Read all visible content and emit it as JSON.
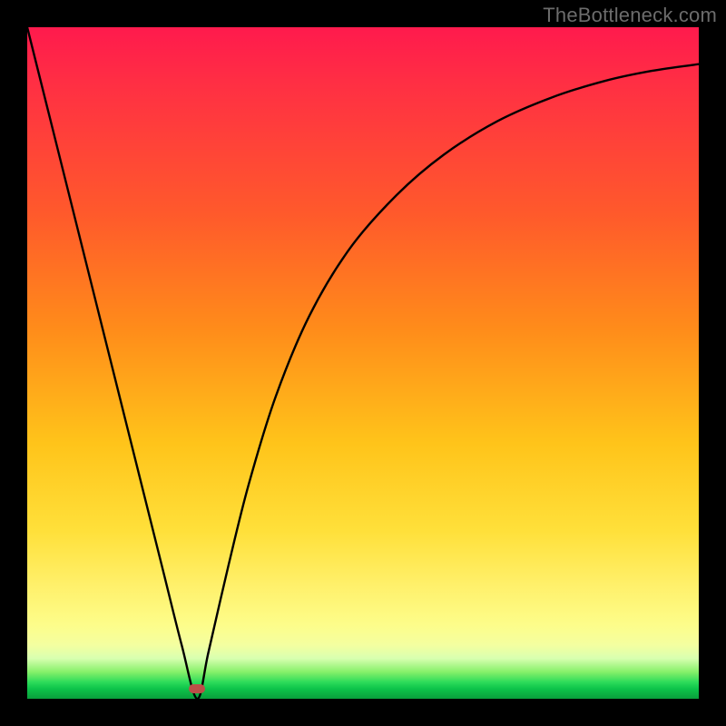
{
  "watermark": "TheBottleneck.com",
  "marker": {
    "x_frac": 0.253,
    "y_frac": 0.985
  },
  "chart_data": {
    "type": "line",
    "title": "",
    "xlabel": "",
    "ylabel": "",
    "xlim": [
      0,
      100
    ],
    "ylim": [
      0,
      100
    ],
    "grid": false,
    "legend": false,
    "annotations": [
      "TheBottleneck.com"
    ],
    "series": [
      {
        "name": "curve",
        "x": [
          0,
          5,
          10,
          15,
          20,
          23,
          25.3,
          27,
          30,
          33,
          37,
          42,
          48,
          55,
          62,
          70,
          78,
          86,
          93,
          100
        ],
        "y": [
          100,
          80,
          60,
          40,
          20,
          8,
          0,
          7,
          20,
          32,
          45,
          57,
          67,
          75,
          81,
          86,
          89.5,
          92,
          93.5,
          94.5
        ]
      }
    ],
    "background_gradient": {
      "direction": "vertical",
      "stops": [
        {
          "pos": 0.0,
          "color": "#ff1a4d"
        },
        {
          "pos": 0.28,
          "color": "#ff5a2b"
        },
        {
          "pos": 0.62,
          "color": "#ffc41a"
        },
        {
          "pos": 0.89,
          "color": "#fdfd8a"
        },
        {
          "pos": 0.96,
          "color": "#86f06a"
        },
        {
          "pos": 1.0,
          "color": "#0a9e3c"
        }
      ]
    },
    "marker": {
      "shape": "rounded-rect",
      "color": "#bb4f48",
      "x": 25.3,
      "y": 1.5
    }
  }
}
